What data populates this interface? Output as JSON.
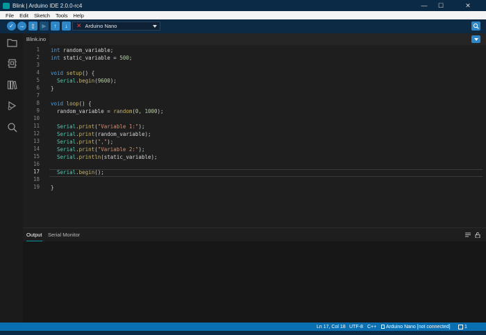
{
  "window": {
    "title": "Blink | Arduino IDE 2.0.0-rc4",
    "controls": {
      "minimize": "—",
      "maximize": "☐",
      "close": "✕"
    }
  },
  "menu": [
    "File",
    "Edit",
    "Sketch",
    "Tools",
    "Help"
  ],
  "toolbar": {
    "board": "Arduino Nano",
    "board_error_icon": "✕",
    "buttons": [
      {
        "name": "verify",
        "icon": "check-icon",
        "glyph": "✓"
      },
      {
        "name": "upload",
        "icon": "arrow-right-icon",
        "glyph": "→"
      },
      {
        "name": "new-sketch",
        "icon": "new-file-icon",
        "glyph": "▯"
      },
      {
        "name": "debug",
        "icon": "debug-icon",
        "glyph": "▶"
      },
      {
        "name": "open",
        "icon": "arrow-up-icon",
        "glyph": "↑"
      },
      {
        "name": "save",
        "icon": "arrow-down-icon",
        "glyph": "↓"
      }
    ],
    "serial_monitor_icon": "magnifier-icon"
  },
  "sidebar": [
    "folder-icon",
    "board-icon",
    "library-icon",
    "debug-run-icon",
    "search-icon"
  ],
  "editor": {
    "tab": "Blink.ino",
    "active_line": 17,
    "lines": [
      "1",
      "2",
      "3",
      "4",
      "5",
      "6",
      "7",
      "8",
      "9",
      "10",
      "11",
      "12",
      "13",
      "14",
      "15",
      "16",
      "17",
      "18",
      "19"
    ]
  },
  "panel": {
    "tabs": [
      "Output",
      "Serial Monitor"
    ],
    "active_tab": "Output"
  },
  "status": {
    "position": "Ln 17, Col 18",
    "encoding": "UTF-8",
    "language": "C++",
    "board": "Arduino Nano [not connected]",
    "notifications": "1"
  },
  "colors": {
    "accent": "#00979d",
    "toolbar": "#0c2a43",
    "statusbar": "#0a6fb0",
    "keyword": "#569cd6",
    "function": "#c9b56a",
    "type": "#4ec9b0",
    "number": "#b5cea8",
    "string": "#ce9178"
  }
}
